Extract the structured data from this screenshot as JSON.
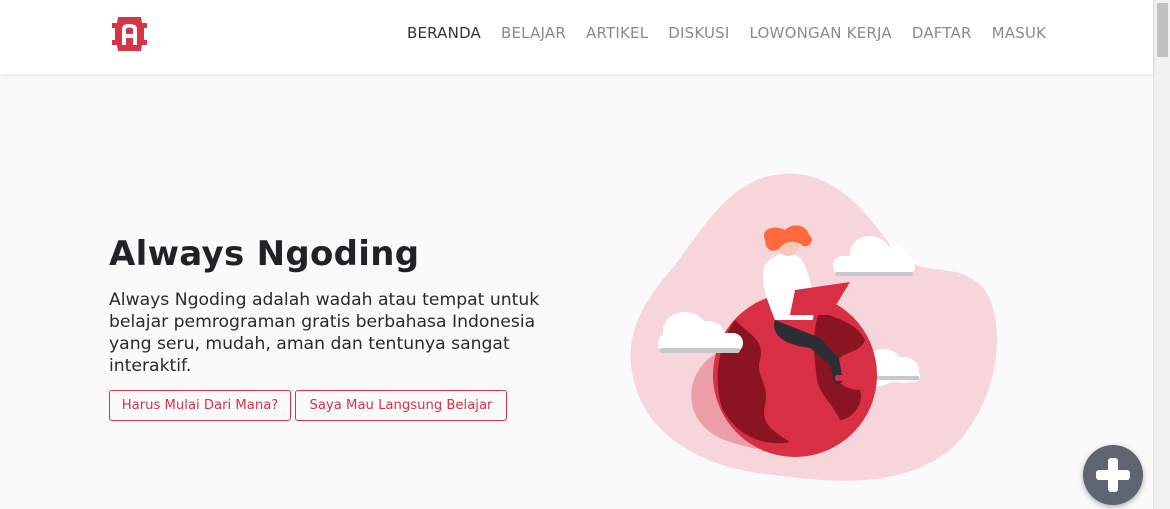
{
  "nav": {
    "links": [
      {
        "label": "BERANDA",
        "active": true
      },
      {
        "label": "BELAJAR",
        "active": false
      },
      {
        "label": "ARTIKEL",
        "active": false
      },
      {
        "label": "DISKUSI",
        "active": false
      },
      {
        "label": "LOWONGAN KERJA",
        "active": false
      },
      {
        "label": "DAFTAR",
        "active": false
      },
      {
        "label": "MASUK",
        "active": false
      }
    ]
  },
  "hero": {
    "title": "Always Ngoding",
    "description": "Always Ngoding adalah wadah atau tempat untuk belajar pemrograman gratis berbahasa Indonesia yang seru, mudah, aman dan tentunya sangat interaktif.",
    "buttons": {
      "start": "Harus Mulai Dari Mana?",
      "direct": "Saya Mau Langsung Belajar"
    }
  },
  "colors": {
    "accent": "#d63447",
    "blob": "#f6d6da",
    "fab": "#5f6570"
  },
  "icons": {
    "logo": "always-ngoding-logo",
    "fab": "plus-icon"
  }
}
